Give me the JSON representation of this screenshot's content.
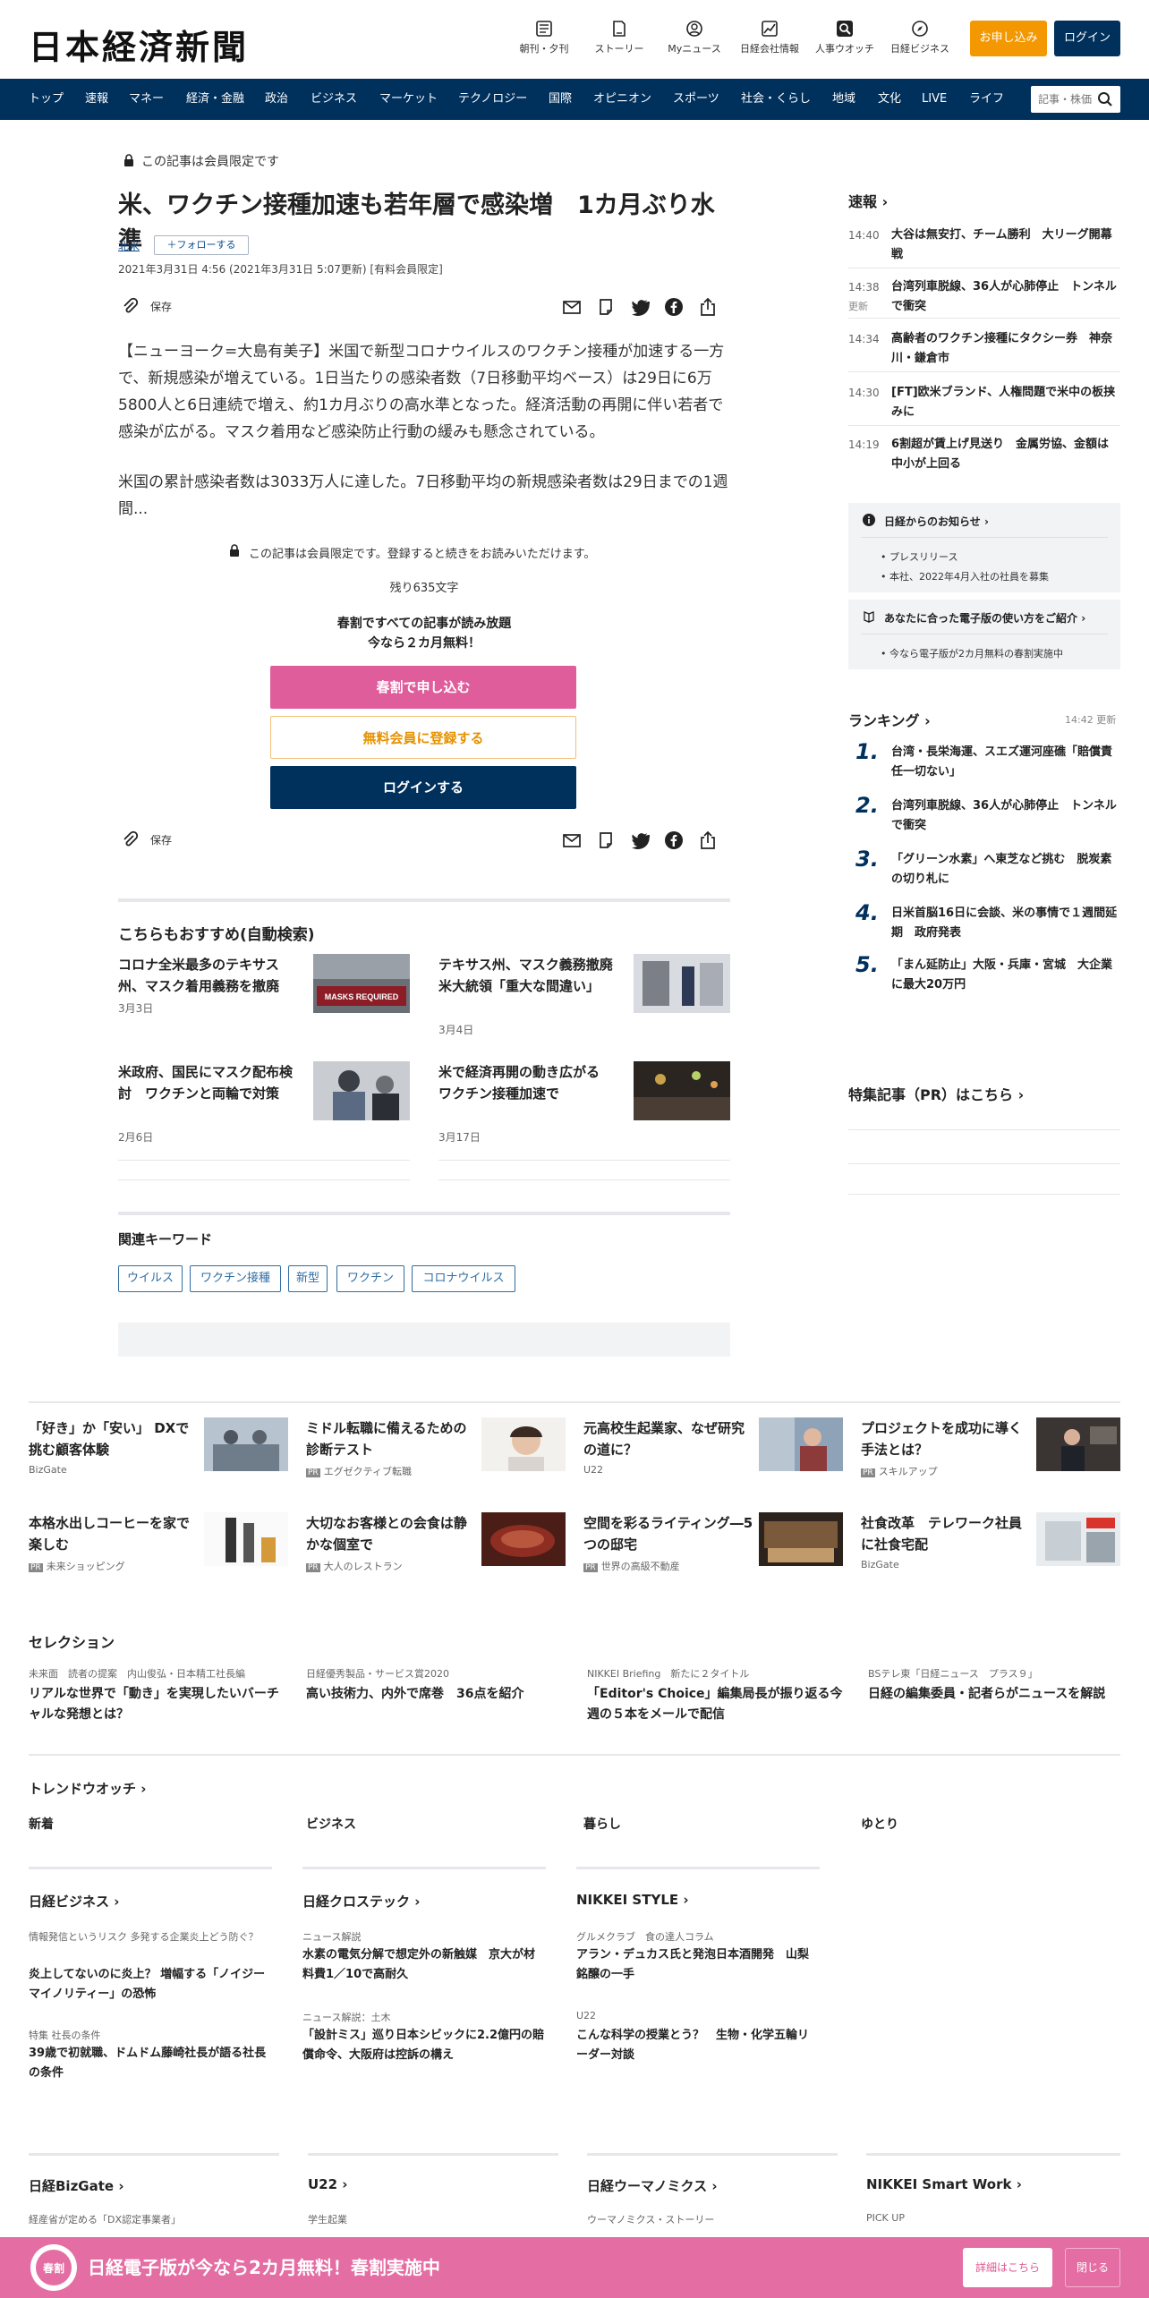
{
  "header": {
    "logo": "日本経済新聞",
    "icons": [
      {
        "label": "朝刊・夕刊",
        "icon": "newspaper-icon"
      },
      {
        "label": "ストーリー",
        "icon": "document-icon"
      },
      {
        "label": "Myニュース",
        "icon": "user-icon"
      },
      {
        "label": "日経会社情報",
        "icon": "chart-icon"
      },
      {
        "label": "人事ウオッチ",
        "icon": "search-icon"
      },
      {
        "label": "日経ビジネス",
        "icon": "compass-icon"
      }
    ],
    "apply_label": "お申し込み",
    "login_label": "ログイン"
  },
  "nav": {
    "items": [
      "トップ",
      "速報",
      "マネー",
      "経済・金融",
      "政治",
      "ビジネス",
      "マーケット",
      "テクノロジー",
      "国際",
      "オピニオン",
      "スポーツ",
      "社会・くらし",
      "地域",
      "文化",
      "LIVE",
      "ライフ"
    ],
    "search_placeholder": "記事・株価"
  },
  "article": {
    "members_only": "この記事は会員限定です",
    "title": "米、ワクチン接種加速も若年層で感染増　1カ月ぶり水準",
    "region": "北米",
    "follow": "フォローする",
    "dateline": "2021年3月31日 4:56 (2021年3月31日 5:07更新) [有料会員限定]",
    "save": "保存",
    "para1": "【ニューヨーク=大島有美子】米国で新型コロナウイルスのワクチン接種が加速する一方で、新規感染が増えている。1日当たりの感染者数（7日移動平均ベース）は29日に6万5800人と6日連続で増え、約1カ月ぶりの高水準となった。経済活動の再開に伴い若者で感染が広がる。マスク着用など感染防止行動の緩みも懸念されている。",
    "para2": "米国の累計感染者数は3033万人に達した。7日移動平均の新規感染者数は29日までの1週間...",
    "lock_note": "この記事は会員限定です。登録すると続きをお読みいただけます。",
    "remaining": "残り635文字",
    "promo1": "春割ですべての記事が読み放題",
    "promo2": "今なら２カ月無料！",
    "cta_spring": "春割で申し込む",
    "cta_free": "無料会員に登録する",
    "cta_login": "ログインする"
  },
  "recommend": {
    "title": "こちらもおすすめ(自動検索)",
    "items": [
      {
        "title": "コロナ全米最多のテキサス州、マスク着用義務を撤廃",
        "date": "3月3日",
        "img_text": "MASKS REQUIRED"
      },
      {
        "title": "テキサス州、マスク義務撤廃　米大統領「重大な間違い」",
        "date": "3月4日"
      },
      {
        "title": "米政府、国民にマスク配布検討　ワクチンと両輪で対策",
        "date": "2月6日"
      },
      {
        "title": "米で経済再開の動き広がる　ワクチン接種加速で",
        "date": "3月17日"
      }
    ]
  },
  "keywords": {
    "title": "関連キーワード",
    "items": [
      "ウイルス",
      "ワクチン接種",
      "新型",
      "ワクチン",
      "コロナウイルス"
    ]
  },
  "sidebar": {
    "flash_title": "速報",
    "flash": [
      {
        "time": "14:40",
        "text": "大谷は無安打、チーム勝利　大リーグ開幕戦"
      },
      {
        "time": "14:38",
        "note": "更新",
        "text": "台湾列車脱線、36人が心肺停止　トンネルで衝突"
      },
      {
        "time": "14:34",
        "text": "高齢者のワクチン接種にタクシー券　神奈川・鎌倉市"
      },
      {
        "time": "14:30",
        "text": "[FT]欧米ブランド、人権問題で米中の板挟みに"
      },
      {
        "time": "14:19",
        "text": "6割超が賃上げ見送り　金属労協、金額は中小が上回る"
      }
    ],
    "notice_title": "日経からのお知らせ",
    "notices": [
      "プレスリリース",
      "本社、2022年4月入社の社員を募集"
    ],
    "guide_title": "あなたに合った電子版の使い方をご紹介",
    "guide_items": [
      "今なら電子版が2カ月無料の春割実施中"
    ],
    "ranking_title": "ランキング",
    "ranking_time": "14:42  更新",
    "ranking": [
      {
        "n": "1.",
        "text": "台湾・長栄海運、スエズ運河座礁「賠償責任一切ない」"
      },
      {
        "n": "2.",
        "text": "台湾列車脱線、36人が心肺停止　トンネルで衝突"
      },
      {
        "n": "3.",
        "text": "「グリーン水素」へ東芝など挑む　脱炭素の切り札に"
      },
      {
        "n": "4.",
        "text": "日米首脳16日に会談、米の事情で１週間延期　政府発表"
      },
      {
        "n": "5.",
        "text": "「まん延防止」大阪・兵庫・宮城　大企業に最大20万円"
      }
    ],
    "pr_title": "特集記事（PR）はこちら"
  },
  "pr_items": [
    {
      "title": "「好き」か「安い」 DXで挑む顧客体験",
      "source": "BizGate",
      "pr": false
    },
    {
      "title": "ミドル転職に備えるための診断テスト",
      "source": "エグゼクティブ転職",
      "pr": true
    },
    {
      "title": "元高校生起業家、なぜ研究の道に？",
      "source": "U22",
      "pr": false
    },
    {
      "title": "プロジェクトを成功に導く手法とは？",
      "source": "スキルアップ",
      "pr": true
    },
    {
      "title": "本格水出しコーヒーを家で楽しむ",
      "source": "未来ショッピング",
      "pr": true
    },
    {
      "title": "大切なお客様との会食は静かな個室で",
      "source": "大人のレストラン",
      "pr": true
    },
    {
      "title": "空間を彩るライティング―5つの邸宅",
      "source": "世界の高級不動産",
      "pr": true
    },
    {
      "title": "社食改革　テレワーク社員に社食宅配",
      "source": "BizGate",
      "pr": false
    }
  ],
  "selection": {
    "title": "セレクション",
    "items": [
      {
        "kicker": "未来面　読者の提案　内山俊弘・日本精工社長編",
        "title": "リアルな世界で「動き」を実現したいバーチャルな発想とは？"
      },
      {
        "kicker": "日経優秀製品・サービス賞2020",
        "title": "高い技術力、内外で席巻　36点を紹介"
      },
      {
        "kicker": "NIKKEI Briefing　新たに２タイトル",
        "title": "「Editor's Choice」編集局長が振り返る今週の５本をメールで配信"
      },
      {
        "kicker": "BSテレ東「日経ニュース　プラス９」",
        "title": "日経の編集委員・記者らがニュースを解説"
      }
    ]
  },
  "trend": {
    "title": "トレンドウオッチ",
    "tabs": [
      "新着",
      "ビジネス",
      "暮らし",
      "ゆとり"
    ]
  },
  "groups": [
    {
      "title": "日経ビジネス",
      "items": [
        {
          "kicker": "情報発信というリスク 多発する企業炎上どう防ぐ？",
          "title": "炎上してないのに炎上？ 増幅する「ノイジーマイノリティー」の恐怖"
        },
        {
          "kicker": "特集 社長の条件",
          "title": "39歳で初就職、ドムドム藤崎社長が語る社長の条件"
        }
      ]
    },
    {
      "title": "日経クロステック",
      "items": [
        {
          "kicker": "ニュース解説",
          "title": "水素の電気分解で想定外の新触媒　京大が材料費1／10で高耐久"
        },
        {
          "kicker": "ニュース解説：土木",
          "title": "「設計ミス」巡り日本シビックに2.2億円の賠償命令、大阪府は控訴の構え"
        }
      ]
    },
    {
      "title": "NIKKEI STYLE",
      "items": [
        {
          "kicker": "グルメクラブ　食の達人コラム",
          "title": "アラン・デュカス氏と発泡日本酒開発　山梨銘醸の一手"
        },
        {
          "kicker": "U22",
          "title": "こんな科学の授業とう？　生物・化学五輪リーダー対談"
        }
      ]
    }
  ],
  "bottom_groups": [
    {
      "title": "日経BizGate",
      "kicker": "経産省が定める「DX認定事業者」"
    },
    {
      "title": "U22",
      "kicker": "学生起業"
    },
    {
      "title": "日経ウーマノミクス",
      "kicker": "ウーマノミクス・ストーリー"
    },
    {
      "title": "NIKKEI Smart Work",
      "kicker": "PICK UP"
    }
  ],
  "banner": {
    "badge": "春割",
    "text": "日経電子版が今なら2カ月無料！春割実施中",
    "detail_btn": "詳細はこちら",
    "close_btn": "閉じる"
  },
  "colors": {
    "navy": "#00305c",
    "orange": "#f39800",
    "pink": "#df5d9b"
  }
}
